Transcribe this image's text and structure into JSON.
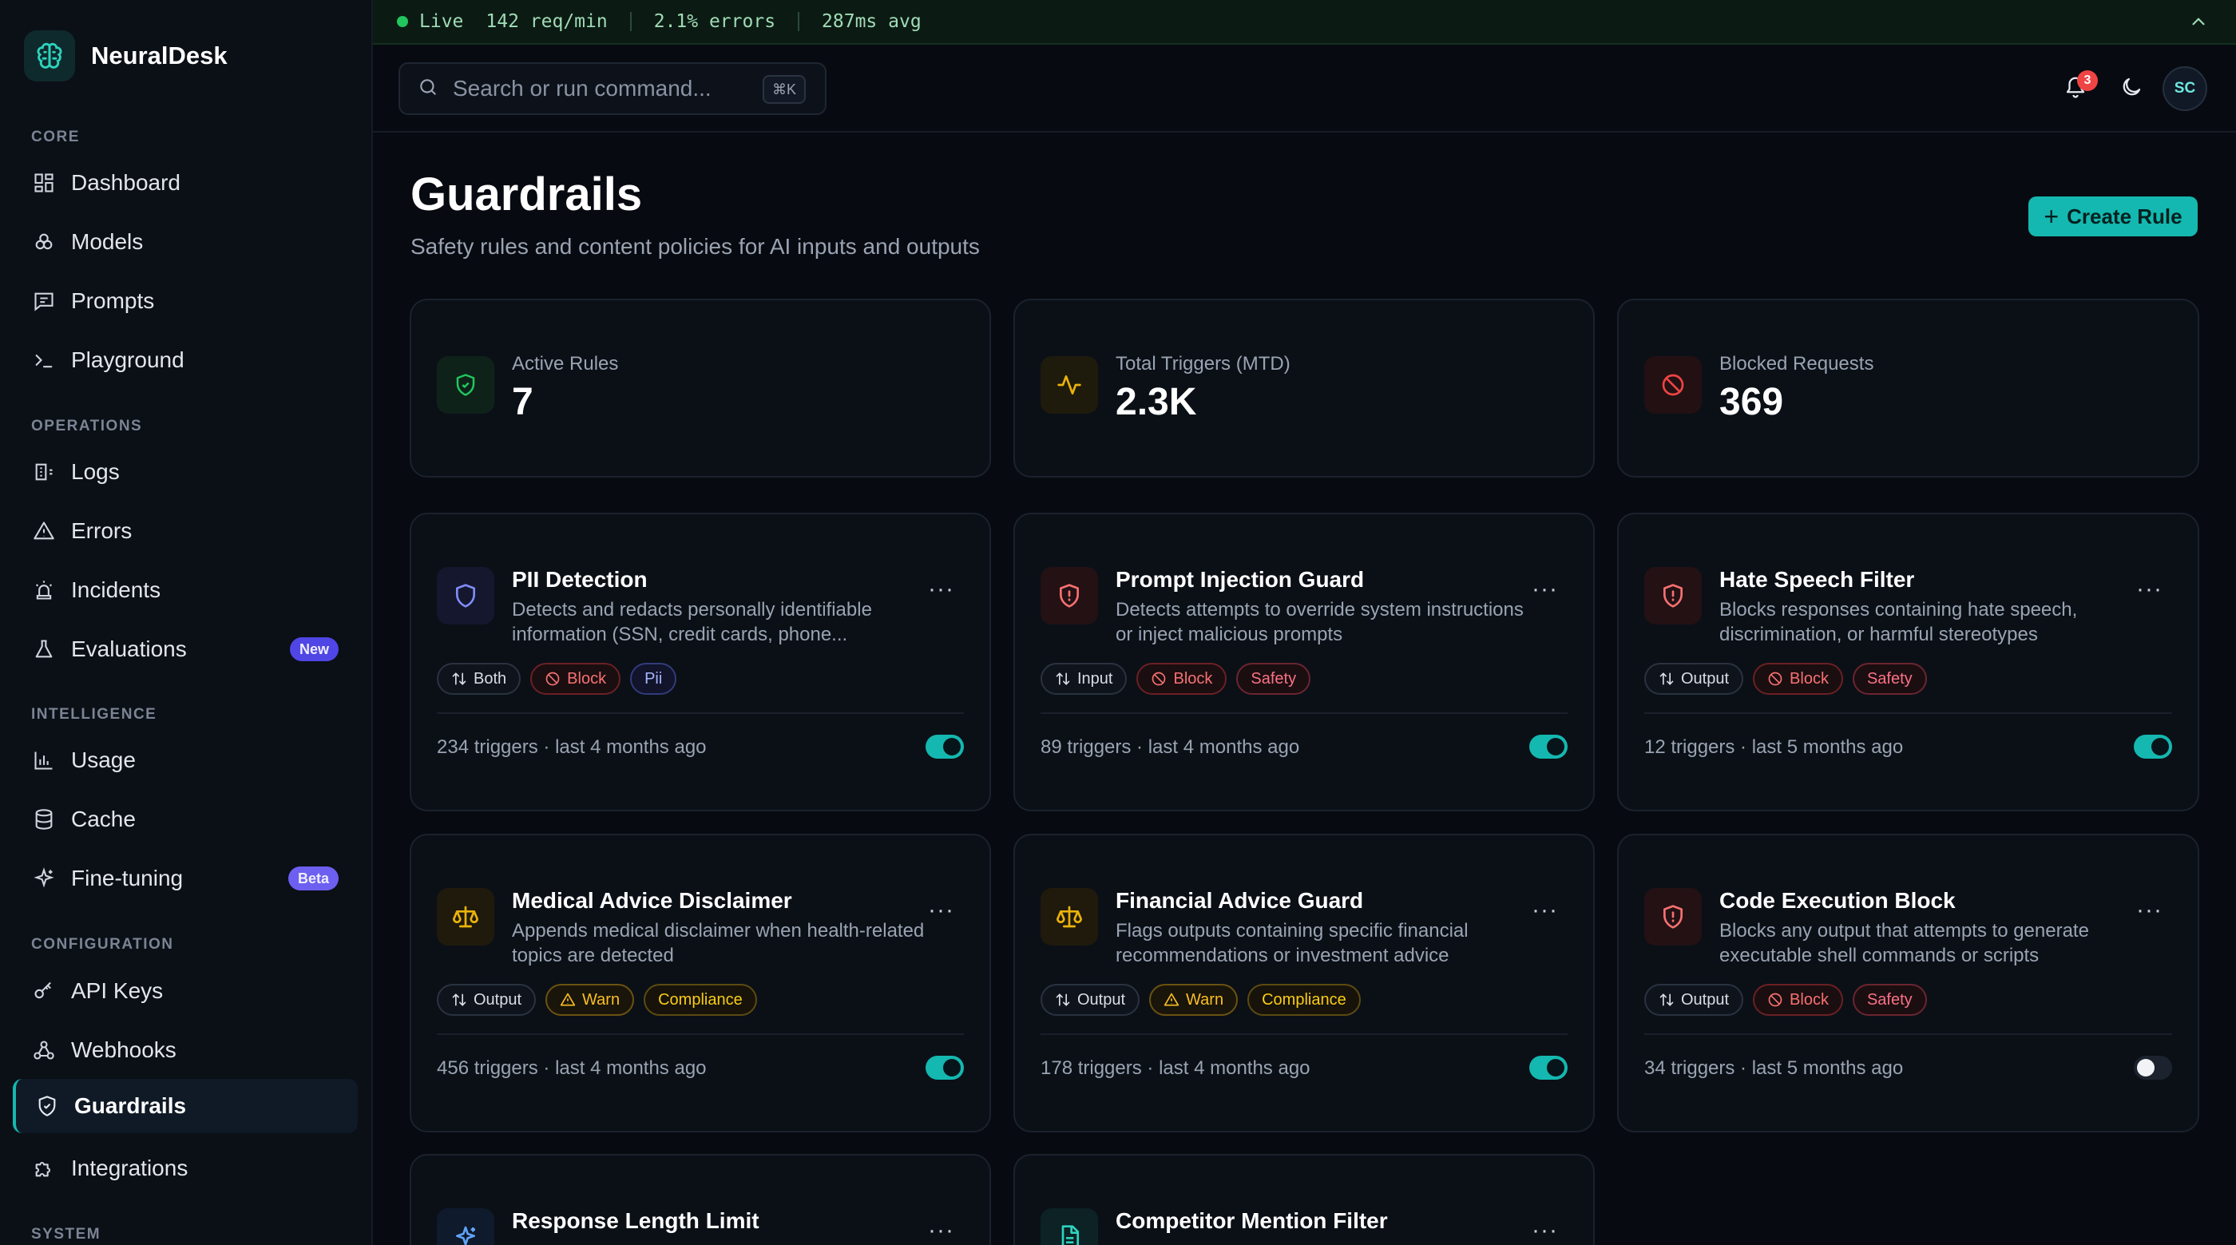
{
  "app": {
    "name": "NeuralDesk"
  },
  "status": {
    "live": "Live",
    "rpm": "142 req/min",
    "errors": "2.1% errors",
    "latency": "287ms avg"
  },
  "search": {
    "placeholder": "Search or run command...",
    "shortcut": "⌘K"
  },
  "header": {
    "notifications": "3",
    "avatar": "SC"
  },
  "sidebar": {
    "sections": [
      {
        "title": "CORE",
        "items": [
          {
            "label": "Dashboard",
            "icon": "grid-icon"
          },
          {
            "label": "Models",
            "icon": "cubes-icon"
          },
          {
            "label": "Prompts",
            "icon": "message-square-icon"
          },
          {
            "label": "Playground",
            "icon": "terminal-icon"
          }
        ]
      },
      {
        "title": "OPERATIONS",
        "items": [
          {
            "label": "Logs",
            "icon": "logs-icon"
          },
          {
            "label": "Errors",
            "icon": "warning-triangle-icon"
          },
          {
            "label": "Incidents",
            "icon": "siren-icon"
          },
          {
            "label": "Evaluations",
            "icon": "flask-icon",
            "badge": "New"
          }
        ]
      },
      {
        "title": "INTELLIGENCE",
        "items": [
          {
            "label": "Usage",
            "icon": "bar-chart-icon"
          },
          {
            "label": "Cache",
            "icon": "database-icon"
          },
          {
            "label": "Fine-tuning",
            "icon": "sparkles-icon",
            "badge": "Beta"
          }
        ]
      },
      {
        "title": "CONFIGURATION",
        "items": [
          {
            "label": "API Keys",
            "icon": "key-icon"
          },
          {
            "label": "Webhooks",
            "icon": "webhook-icon"
          },
          {
            "label": "Guardrails",
            "icon": "shield-icon",
            "active": true
          },
          {
            "label": "Integrations",
            "icon": "puzzle-icon"
          }
        ]
      },
      {
        "title": "SYSTEM",
        "items": []
      }
    ]
  },
  "page": {
    "title": "Guardrails",
    "subtitle": "Safety rules and content policies for AI inputs and outputs",
    "create_label": "Create Rule"
  },
  "stats": [
    {
      "label": "Active Rules",
      "value": "7",
      "icon": "shield-check-icon",
      "color": "#22c55e"
    },
    {
      "label": "Total Triggers (MTD)",
      "value": "2.3K",
      "icon": "activity-icon",
      "color": "#eab308"
    },
    {
      "label": "Blocked Requests",
      "value": "369",
      "icon": "ban-icon",
      "color": "#ef4444"
    }
  ],
  "rules": [
    {
      "name": "PII Detection",
      "desc": "Detects and redacts personally identifiable information (SSN, credit cards, phone...",
      "direction": "Both",
      "action": "Block",
      "category": "Pii",
      "footer": "234 triggers · last 4 months ago",
      "enabled": true,
      "icon": "shield-icon",
      "color": "#6366f1"
    },
    {
      "name": "Prompt Injection Guard",
      "desc": "Detects attempts to override system instructions or inject malicious prompts",
      "direction": "Input",
      "action": "Block",
      "category": "Safety",
      "footer": "89 triggers · last 4 months ago",
      "enabled": true,
      "icon": "shield-alert-icon",
      "color": "#ef4444"
    },
    {
      "name": "Hate Speech Filter",
      "desc": "Blocks responses containing hate speech, discrimination, or harmful stereotypes",
      "direction": "Output",
      "action": "Block",
      "category": "Safety",
      "footer": "12 triggers · last 5 months ago",
      "enabled": true,
      "icon": "shield-alert-icon",
      "color": "#ef4444"
    },
    {
      "name": "Medical Advice Disclaimer",
      "desc": "Appends medical disclaimer when health-related topics are detected",
      "direction": "Output",
      "action": "Warn",
      "category": "Compliance",
      "footer": "456 triggers · last 4 months ago",
      "enabled": true,
      "icon": "scale-icon",
      "color": "#eab308"
    },
    {
      "name": "Financial Advice Guard",
      "desc": "Flags outputs containing specific financial recommendations or investment advice",
      "direction": "Output",
      "action": "Warn",
      "category": "Compliance",
      "footer": "178 triggers · last 4 months ago",
      "enabled": true,
      "icon": "scale-icon",
      "color": "#eab308"
    },
    {
      "name": "Code Execution Block",
      "desc": "Blocks any output that attempts to generate executable shell commands or scripts",
      "direction": "Output",
      "action": "Block",
      "category": "Safety",
      "footer": "34 triggers · last 5 months ago",
      "enabled": false,
      "icon": "shield-alert-icon",
      "color": "#ef4444"
    },
    {
      "name": "Response Length Limit",
      "desc": "",
      "direction": "",
      "action": "",
      "category": "",
      "footer": "",
      "enabled": true,
      "icon": "sparkles-icon",
      "color": "#3b82f6"
    },
    {
      "name": "Competitor Mention Filter",
      "desc": "",
      "direction": "",
      "action": "",
      "category": "",
      "footer": "",
      "enabled": true,
      "icon": "file-text-icon",
      "color": "#14b8a6"
    }
  ]
}
